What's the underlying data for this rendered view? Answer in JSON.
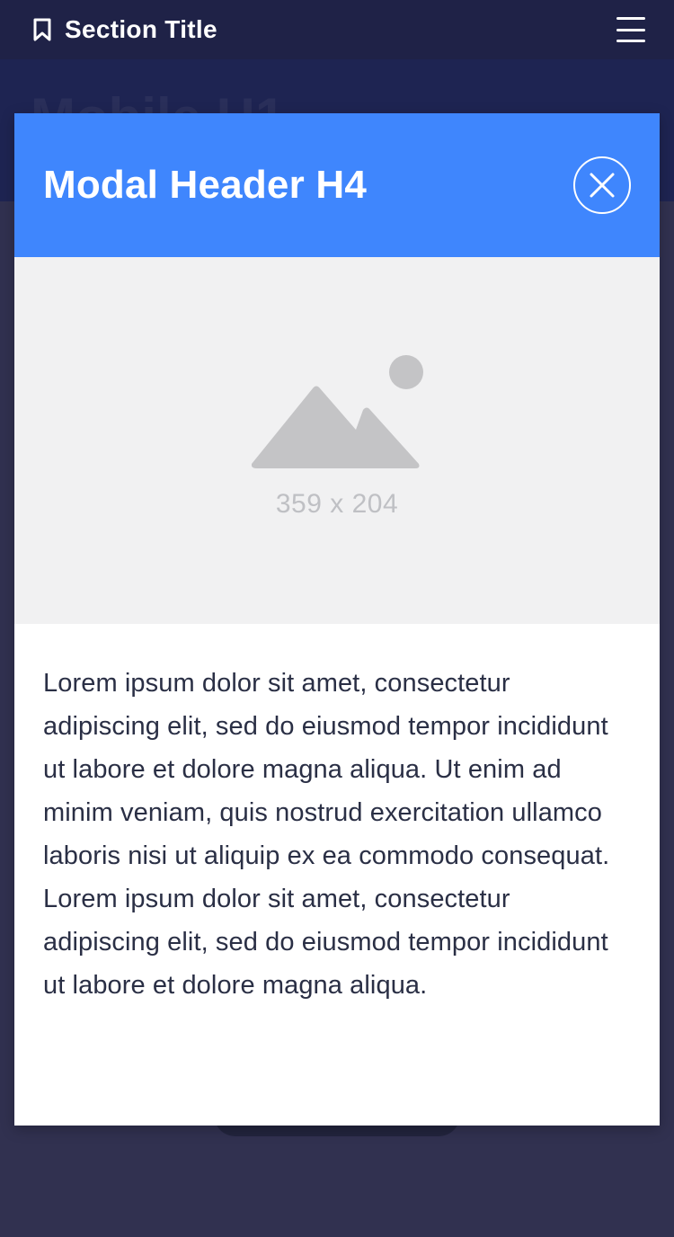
{
  "topbar": {
    "bookmark_icon": "bookmark-icon",
    "section_title": "Section Title",
    "menu_icon": "hamburger-menu-icon"
  },
  "background": {
    "heading": "Mobile H1"
  },
  "modal": {
    "title": "Modal Header H4",
    "close_icon": "close-icon",
    "image": {
      "icon": "image-placeholder-icon",
      "size_label": "359 x 204"
    },
    "body_text": "Lorem ipsum dolor sit amet, consectetur adipiscing elit, sed do eiusmod tempor incididunt ut labore et dolore magna aliqua. Ut enim ad minim veniam, quis nostrud exercitation ullamco laboris nisi ut aliquip ex ea commodo consequat. Lorem ipsum dolor sit amet, consectetur adipiscing elit, sed do eiusmod tempor incididunt ut labore et dolore magna aliqua."
  },
  "colors": {
    "topbar_bg": "#1f2247",
    "overlay_bg": "#313150",
    "modal_header_bg": "#3f86fd",
    "placeholder_bg": "#f1f1f2",
    "placeholder_icon": "#c4c4c6",
    "body_text": "#2a2f45"
  }
}
